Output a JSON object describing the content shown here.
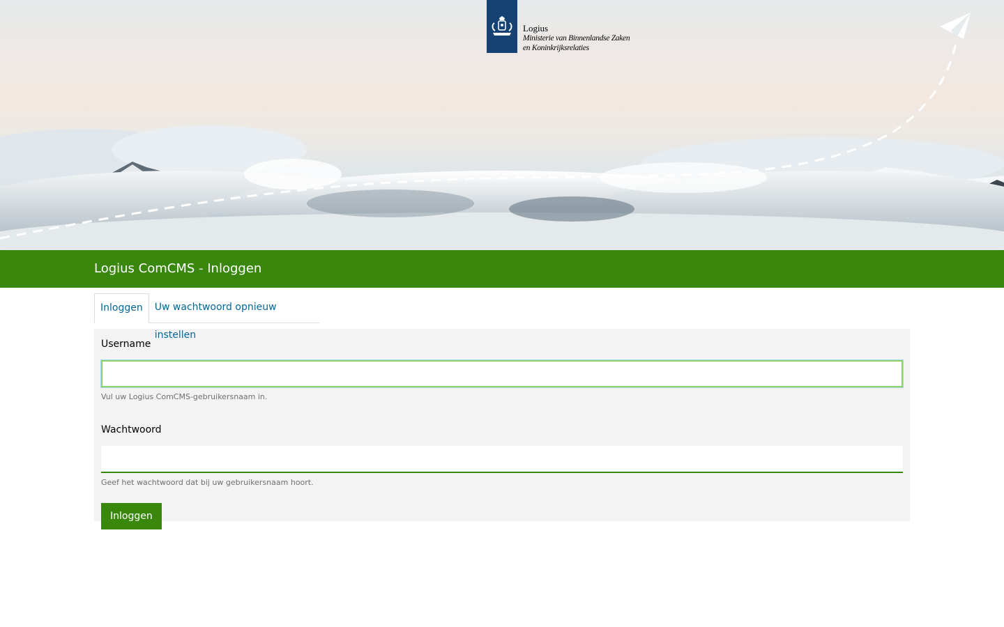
{
  "header": {
    "logo": {
      "name": "Logius",
      "line2": "Ministerie van Binnenlandse Zaken",
      "line3": "en Koninkrijksrelaties"
    },
    "band_title": "Logius ComCMS - Inloggen"
  },
  "tabs": [
    {
      "label": "Inloggen",
      "active": true
    },
    {
      "label": "Uw wachtwoord opnieuw instellen",
      "active": false
    }
  ],
  "form": {
    "username": {
      "label": "Username",
      "value": "",
      "hint": "Vul uw Logius ComCMS-gebruikersnaam in."
    },
    "password": {
      "label": "Wachtwoord",
      "value": "",
      "hint": "Geef het wachtwoord dat bij uw gebruikersnaam hoort."
    },
    "submit_label": "Inloggen"
  },
  "colors": {
    "brand_green": "#39870c",
    "logo_blue": "#154273",
    "link_blue": "#01689b"
  },
  "icons": [
    "coat-of-arms-icon",
    "paper-plane-icon"
  ]
}
